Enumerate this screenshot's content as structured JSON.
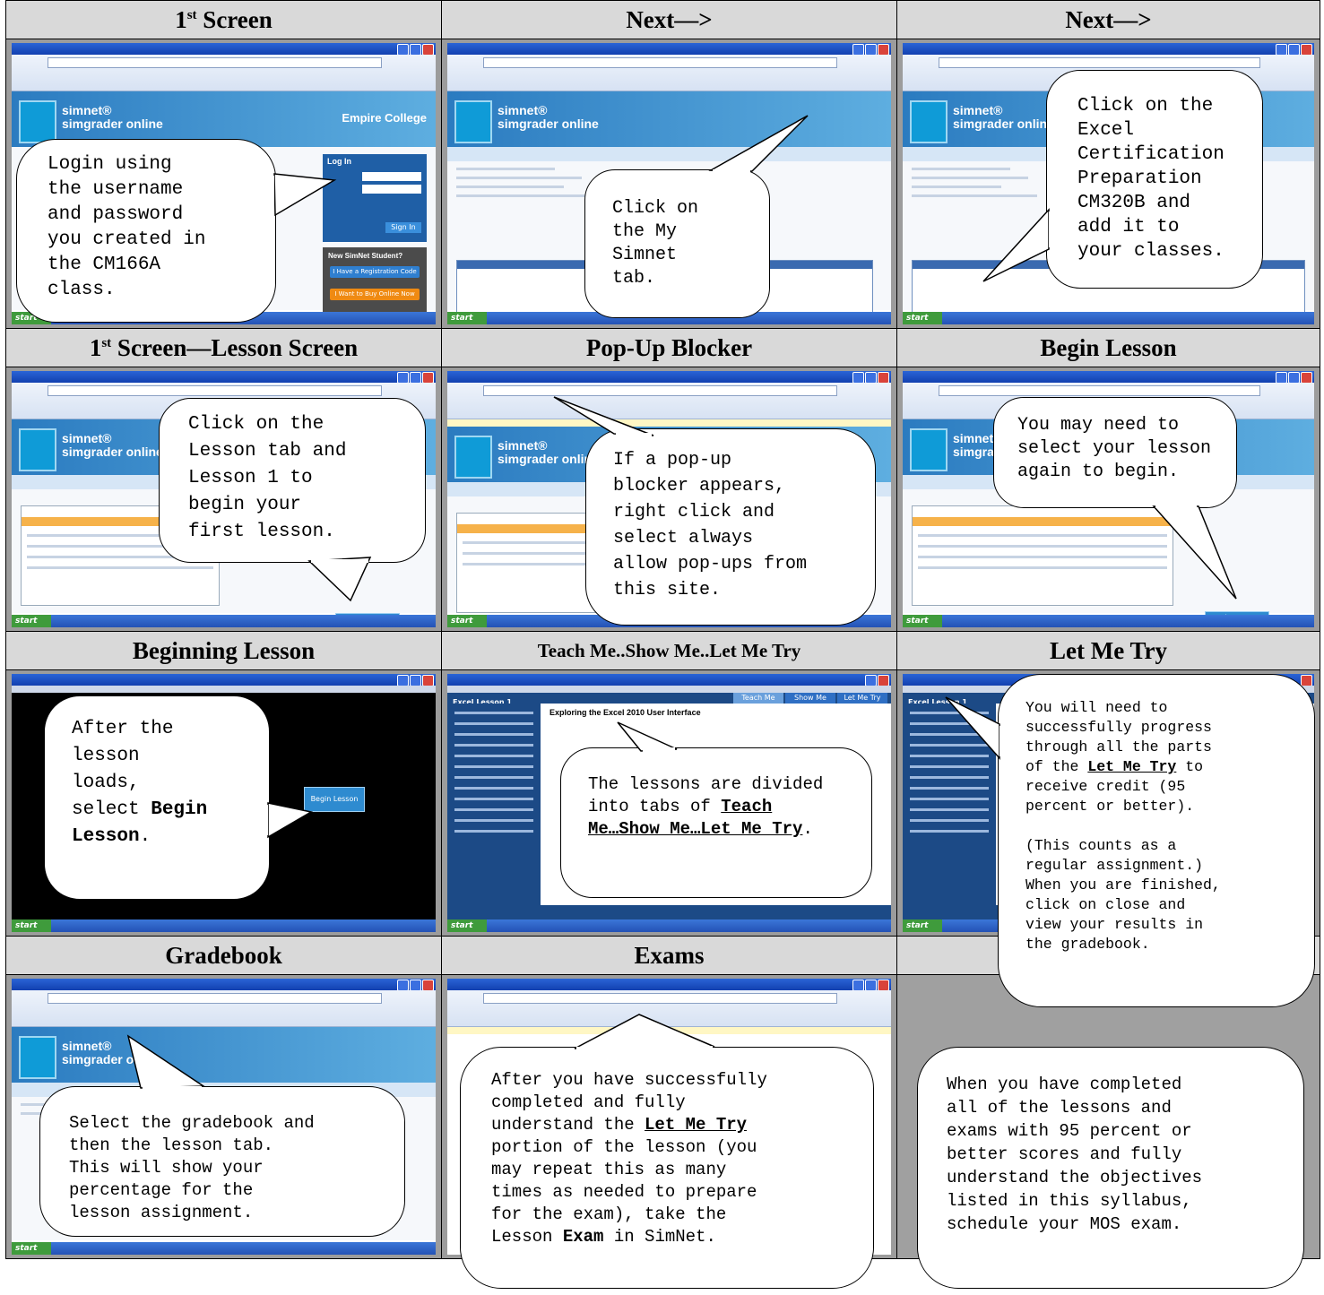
{
  "headers": {
    "r1c1": "1",
    "r1c1_sup": "st",
    "r1c1_tail": " Screen",
    "r1c2": "Next—>",
    "r1c3": "Next—>",
    "r2c1": "1",
    "r2c1_sup": "st",
    "r2c1_tail": " Screen—Lesson Screen",
    "r2c2": "Pop-Up Blocker",
    "r2c3": "Begin Lesson",
    "r3c1": "Beginning Lesson",
    "r3c2": "Teach Me..Show Me..Let Me Try",
    "r3c3": "Let Me Try",
    "r4c1": "Gradebook",
    "r4c2": "Exams",
    "r4c3": ""
  },
  "callouts": {
    "login": "Login using\nthe username\nand password\nyou created in\nthe CM166A\nclass.",
    "my_simnet": "Click on\nthe My\nSimnet\ntab.",
    "excel_cert": "Click on the\nExcel\nCertification\nPreparation\nCM320B and\nadd it to\nyour classes.",
    "lesson_tab": "Click on the\nLesson tab and\nLesson 1 to\nbegin your\nfirst lesson.",
    "popup": "If a pop-up\nblocker appears,\nright click and\nselect always\nallow pop-ups from\nthis site.",
    "select_again": "You may need to\nselect your lesson\nagain to begin.",
    "begin_pre": "After the\nlesson\nloads,\nselect ",
    "begin_bold": "Begin\nLesson",
    "begin_post": ".",
    "tabs_pre": "The lessons are divided\ninto tabs of ",
    "tabs_bold": "Teach\nMe…Show Me…Let Me Try",
    "tabs_post": ".",
    "letmetry_pre": "You will need to\nsuccessfully progress\nthrough all the parts\nof the ",
    "letmetry_bold": "Let Me Try",
    "letmetry_post": " to\nreceive credit (95\npercent or better).\n\n(This counts as a\nregular assignment.)\nWhen you are finished,\nclick on close and\nview your results in\nthe gradebook.",
    "gradebook": "Select the gradebook and\nthen the lesson tab.\nThis will show your\npercentage for the\nlesson assignment.",
    "exams_pre": "After you have successfully\ncompleted and fully\nunderstand the ",
    "exams_bold1": "Let Me Try",
    "exams_mid": "\nportion of the lesson (you\nmay repeat this as many\ntimes as needed to prepare\nfor the exam), take the\nLesson ",
    "exams_bold2": "Exam",
    "exams_post": " in SimNet.",
    "final": "When you have completed\nall of the lessons and\nexams with 95 percent or\nbetter scores and fully\nunderstand the objectives\nlisted in this syllabus,\nschedule your MOS exam."
  },
  "screens": {
    "brand1": "simnet®",
    "brand2": "simgrader online",
    "college": "Empire College",
    "login_title": "Log In",
    "sign_in": "Sign In",
    "new_student": "New SimNet Student?",
    "reg_code": "I Have a Registration Code",
    "buy_online": "I Want to Buy Online Now",
    "begin_btn": "Begin Lesson",
    "take_lesson": "Take Lesson",
    "lesson_heading": "Exploring the Excel 2010 User Interface",
    "excel_lesson": "Excel Lesson 1",
    "teach_me": "Teach Me",
    "show_me": "Show Me",
    "let_me_try": "Let Me Try",
    "start": "start"
  }
}
